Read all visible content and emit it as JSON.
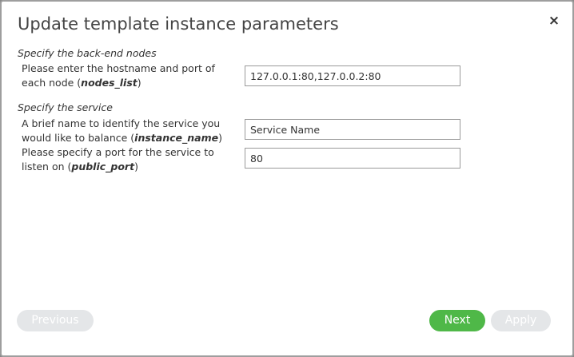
{
  "dialog": {
    "title": "Update template instance parameters",
    "close_symbol": "×"
  },
  "sections": [
    {
      "title": "Specify the back-end nodes",
      "fields": [
        {
          "label_text": "Please enter the hostname and port of each node (",
          "param": "nodes_list",
          "label_suffix": ")",
          "value": "127.0.0.1:80,127.0.0.2:80"
        }
      ]
    },
    {
      "title": "Specify the service",
      "fields": [
        {
          "label_text": "A brief name to identify the service you would like to balance (",
          "param": "instance_name",
          "label_suffix": ")",
          "value": "Service Name"
        },
        {
          "label_text": "Please specify a port for the service to listen on (",
          "param": "public_port",
          "label_suffix": ")",
          "value": "80"
        }
      ]
    }
  ],
  "footer": {
    "previous_label": "Previous",
    "next_label": "Next",
    "apply_label": "Apply"
  },
  "colors": {
    "accent_green": "#4fb848",
    "disabled_button": "#e4e6e8"
  }
}
